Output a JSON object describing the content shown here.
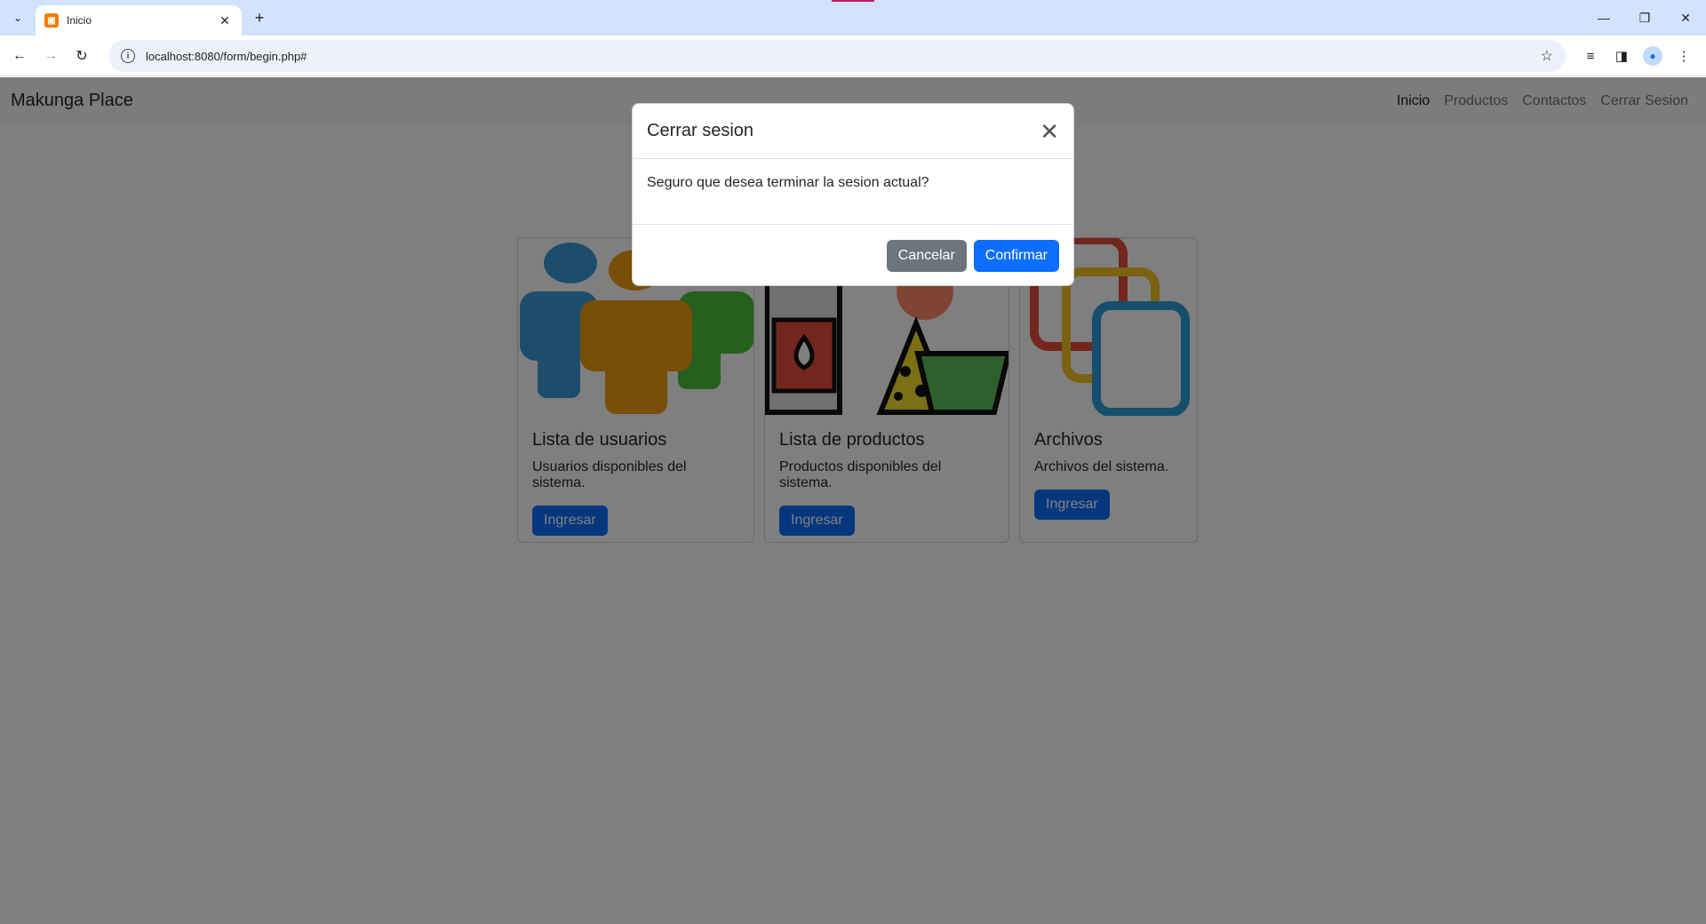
{
  "browser": {
    "tab_title": "Inicio",
    "url": "localhost:8080/form/begin.php#"
  },
  "navbar": {
    "brand": "Makunga Place",
    "links": [
      {
        "label": "Inicio",
        "active": true
      },
      {
        "label": "Productos",
        "active": false
      },
      {
        "label": "Contactos",
        "active": false
      },
      {
        "label": "Cerrar Sesion",
        "active": false
      }
    ]
  },
  "cards": [
    {
      "title": "Lista de usuarios",
      "text": "Usuarios disponibles del sistema.",
      "button": "Ingresar",
      "image": "users-illustration"
    },
    {
      "title": "Lista de productos",
      "text": "Productos disponibles del sistema.",
      "button": "Ingresar",
      "image": "products-illustration"
    },
    {
      "title": "Archivos",
      "text": "Archivos del sistema.",
      "button": "Ingresar",
      "image": "files-illustration"
    }
  ],
  "modal": {
    "title": "Cerrar sesion",
    "body": "Seguro que desea terminar la sesion actual?",
    "cancel_label": "Cancelar",
    "confirm_label": "Confirmar"
  },
  "colors": {
    "primary": "#0d6efd",
    "secondary": "#6c757d",
    "tabstrip": "#d3e3fd"
  }
}
